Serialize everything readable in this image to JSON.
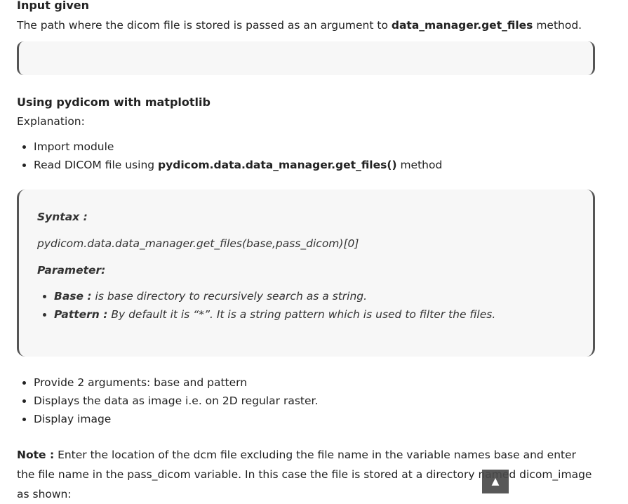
{
  "input_section": {
    "heading": "Input given",
    "text_before": "The path where the dicom file is stored is passed as an argument to ",
    "text_bold": "data_manager.get_files",
    "text_after": " method."
  },
  "pydicom_section": {
    "heading": "Using pydicom with matplotlib",
    "explanation_label": "Explanation:",
    "bullets": [
      {
        "text": "Import module"
      },
      {
        "text_before": "Read DICOM file using ",
        "text_bold": "pydicom.data.data_manager.get_files()",
        "text_after": " method"
      }
    ]
  },
  "syntax_box": {
    "syntax_label": "Syntax :",
    "syntax_code": "pydicom.data.data_manager.get_files(base,pass_dicom)[0]",
    "parameter_label": "Parameter:",
    "params": [
      {
        "name": "Base :",
        "desc": " is base directory to recursively search as a string."
      },
      {
        "name": "Pattern :",
        "desc": " By default it is “*”. It is a string pattern which is used to filter the files."
      }
    ]
  },
  "steps": [
    "Provide 2 arguments: base and pattern",
    "Displays the data as image i.e. on 2D regular raster.",
    "Display image"
  ],
  "note": {
    "label": "Note :",
    "text": " Enter the location of the dcm file excluding the file name in the variable names base and enter the file name in the pass_dicom variable. In this case the file is stored at a directory named dicom_image as shown:"
  },
  "scroll_top": {
    "icon": "up-arrow-icon",
    "glyph": "▲"
  }
}
